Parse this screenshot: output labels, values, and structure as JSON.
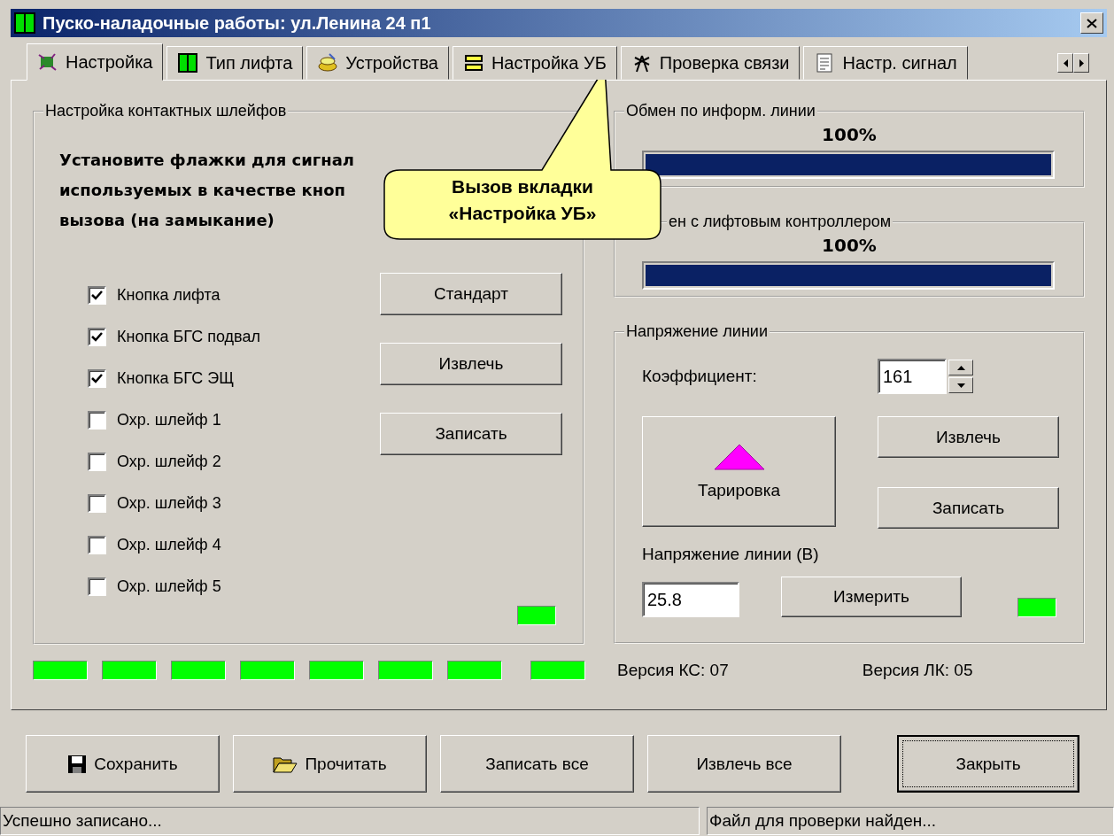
{
  "window": {
    "title": "Пуско-наладочные работы: ул.Ленина 24 п1"
  },
  "tabs": [
    {
      "label": "Настройка",
      "selected": true
    },
    {
      "label": "Тип лифта",
      "selected": false
    },
    {
      "label": "Устройства",
      "selected": false
    },
    {
      "label": "Настройка УБ",
      "selected": false
    },
    {
      "label": "Проверка связи",
      "selected": false
    },
    {
      "label": "Настр. сигнал",
      "selected": false
    }
  ],
  "loops_group": {
    "title": "Настройка  контактных шлейфов",
    "instruction_lines": [
      "Установите флажки для сигнал",
      "используемых в качестве кноп",
      "вызова (на замыкание)"
    ],
    "checkboxes": [
      {
        "label": "Кнопка лифта",
        "checked": true
      },
      {
        "label": "Кнопка БГС подвал",
        "checked": true
      },
      {
        "label": "Кнопка БГС ЭЩ",
        "checked": true
      },
      {
        "label": "Охр. шлейф 1",
        "checked": false
      },
      {
        "label": "Охр. шлейф 2",
        "checked": false
      },
      {
        "label": "Охр. шлейф 3",
        "checked": false
      },
      {
        "label": "Охр. шлейф 4",
        "checked": false
      },
      {
        "label": "Охр. шлейф 5",
        "checked": false
      }
    ],
    "buttons": [
      "Стандарт",
      "Извлечь",
      "Записать"
    ],
    "indicator": {
      "on": true
    }
  },
  "exchange_groups": [
    {
      "title": "Обмен по информ. линии",
      "reading": "100%",
      "level": 1
    },
    {
      "title": "ен с лифтовым контроллером",
      "reading": "100%",
      "level": 1
    }
  ],
  "voltage_group": {
    "title": "Напряжение линии",
    "coefficient_label": "Коэффициент:",
    "coefficient": "161",
    "calibrate_button": "Тарировка",
    "buttons": [
      "Извлечь",
      "Записать"
    ],
    "voltage_label": "Напряжение линии (В)",
    "voltage": "25.8",
    "measure_button": "Измерить",
    "indicator": {
      "on": true
    }
  },
  "indicators": [
    {
      "on": true
    },
    {
      "on": true
    },
    {
      "on": true
    },
    {
      "on": true
    },
    {
      "on": true
    },
    {
      "on": true
    },
    {
      "on": true
    },
    {
      "on": true
    }
  ],
  "versions": [
    "Версия КС: 07",
    "Версия ЛК: 05"
  ],
  "footer_buttons": [
    {
      "label": "Сохранить",
      "focused": false
    },
    {
      "label": "Прочитать",
      "focused": false
    },
    {
      "label": "Записать все",
      "focused": false
    },
    {
      "label": "Извлечь все",
      "focused": false
    },
    {
      "label": "Закрыть",
      "focused": true
    }
  ],
  "status_bar": [
    "Успешно записано...",
    "Файл для проверки найден..."
  ],
  "callout": {
    "lines": [
      "Вызов вкладки",
      "«Настройка УБ»"
    ]
  }
}
